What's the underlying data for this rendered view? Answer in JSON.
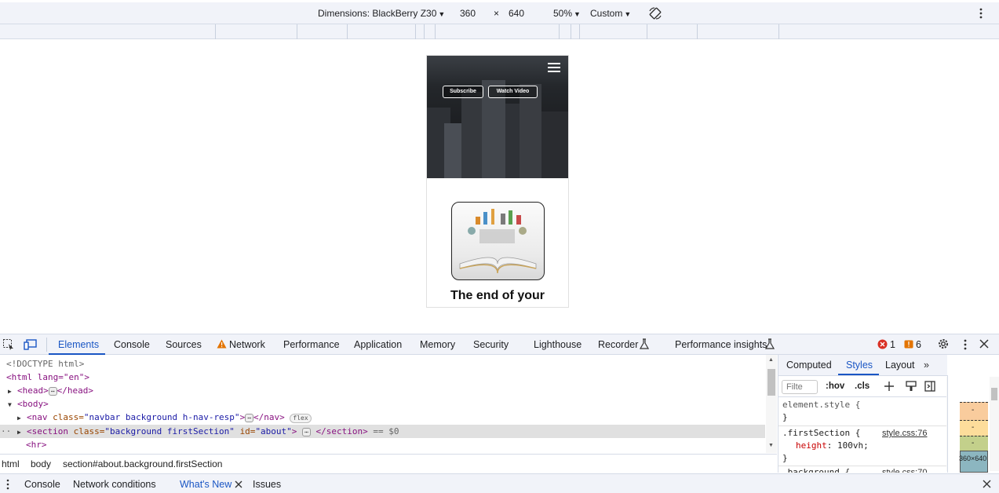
{
  "device_toolbar": {
    "dimensions_label": "Dimensions: BlackBerry Z30",
    "width": "360",
    "times": "×",
    "height": "640",
    "zoom": "50%",
    "throttle": "Custom"
  },
  "page": {
    "subscribe_label": "Subscribe",
    "watch_video_label": "Watch Video",
    "heading": "The end of your"
  },
  "devtools_tabs": [
    "Elements",
    "Console",
    "Sources",
    "Network",
    "Performance",
    "Application",
    "Memory",
    "Security",
    "Lighthouse",
    "Recorder",
    "Performance insights"
  ],
  "status": {
    "errors": "1",
    "warnings": "6"
  },
  "dom": {
    "doctype": "<!DOCTYPE html>",
    "html_open": "<html lang=\"en\">",
    "head": "<head>",
    "head_close": "</head>",
    "body": "<body>",
    "nav_tag": "<nav",
    "nav_attr_name": "class=",
    "nav_attr_val": "\"navbar background h-nav-resp\"",
    "nav_close": "</nav>",
    "flex_badge": "flex",
    "section_tag": "<section",
    "section_class_name": "class=",
    "section_class_val": "\"background firstSection\"",
    "section_id_name": "id=",
    "section_id_val": "\"about\"",
    "section_close": "</section>",
    "selected_marker": "== $0",
    "hr": "<hr>"
  },
  "breadcrumbs": [
    "html",
    "body",
    "section#about.background.firstSection"
  ],
  "styles": {
    "tabs": [
      "Computed",
      "Styles",
      "Layout"
    ],
    "filter_placeholder": "Filte",
    "hov": ":hov",
    "cls": ".cls",
    "rule1_selector": "element.style {",
    "rule1_close": "}",
    "rule2_selector": ".firstSection {",
    "rule2_source": "style.css:76",
    "rule2_prop": "height",
    "rule2_value": "100vh;",
    "rule2_close": "}",
    "rule3_selector": ".background {",
    "rule3_source": "style.css:70"
  },
  "boxmodel": {
    "dash1": "-",
    "dash2": "-",
    "dash3": "-",
    "size": "360×640"
  },
  "drawer_tabs": [
    "Console",
    "Network conditions",
    "What's New",
    "Issues"
  ],
  "colors": {
    "accent": "#1a56c4",
    "error": "#d93025",
    "warning": "#e37400"
  }
}
